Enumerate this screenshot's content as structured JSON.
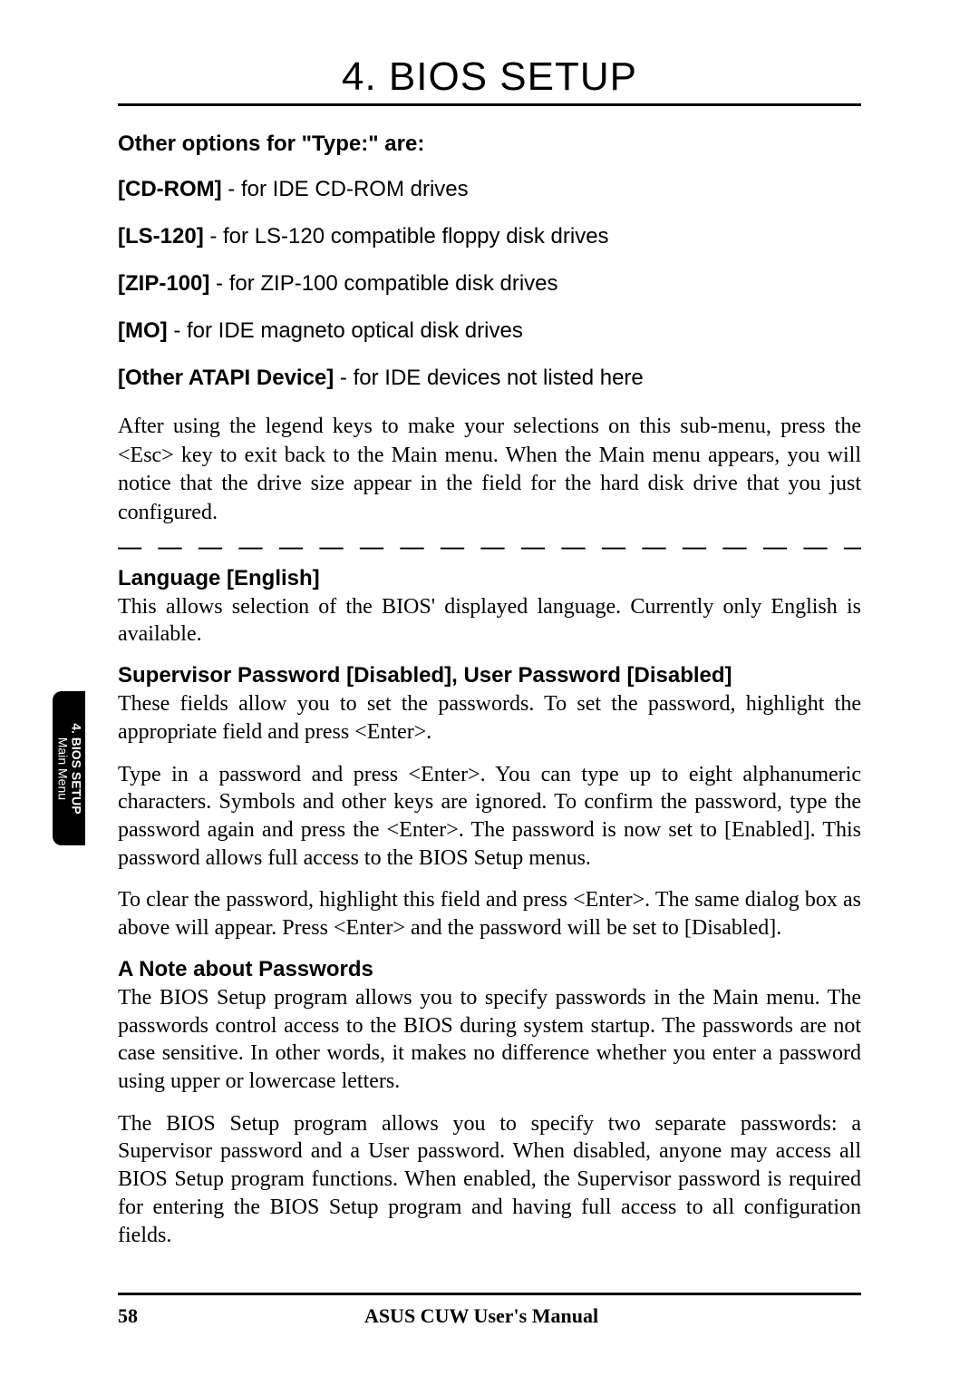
{
  "chapter_title": "4. BIOS SETUP",
  "other_options_heading": "Other options for \"Type:\" are:",
  "options": {
    "cdrom_label": "[CD-ROM]",
    "cdrom_text": " - for IDE CD-ROM drives",
    "ls120_label": "[LS-120]",
    "ls120_text": " - for LS-120 compatible floppy disk drives",
    "zip100_label": "[ZIP-100]",
    "zip100_text": " - for ZIP-100 compatible disk drives",
    "mo_label": "[MO]",
    "mo_text": " - for IDE magneto optical disk drives",
    "atapi_label": "[Other ATAPI Device]",
    "atapi_text": " - for IDE devices not listed here"
  },
  "after_options_para": "After using the legend keys to make your selections on this sub-menu, press the <Esc> key to exit back to the Main menu. When the Main menu appears, you will notice that the drive size appear in the field for the hard disk drive that you just configured.",
  "dashed_divider": "— — — — — — — — — — — — — — — — — — — — — — —",
  "language_heading": "Language [English]",
  "language_para": "This allows selection of the BIOS' displayed language. Currently only English is available.",
  "supervisor_heading": "Supervisor Password [Disabled], User Password [Disabled]",
  "supervisor_para1": "These fields allow you to set the passwords. To set the password, highlight the appropriate field and press <Enter>.",
  "supervisor_para2": "Type in a password and press <Enter>. You can type up to eight alphanumeric characters. Symbols and other keys are ignored. To confirm the password, type the password again and press the <Enter>. The password is now set to [Enabled]. This password allows full access to the BIOS Setup menus.",
  "supervisor_para3": "To clear the password, highlight this field and press <Enter>. The same dialog box as above will appear. Press <Enter> and the password will be set to [Disabled].",
  "note_heading": "A Note about Passwords",
  "note_para1": "The BIOS Setup program allows you to specify passwords in the Main menu. The passwords control access to the BIOS during system startup. The passwords are not case sensitive. In other words, it makes no difference whether you enter a password using upper or lowercase letters.",
  "note_para2": "The BIOS Setup program allows you to specify two separate passwords: a Supervisor password and a User password. When disabled, anyone may access all BIOS Setup program functions. When enabled, the Supervisor password is required for entering the BIOS Setup program and having full access to all configuration fields.",
  "side_tab_bold": "4. BIOS SETUP",
  "side_tab_sub": "Main Menu",
  "footer_page": "58",
  "footer_title": "ASUS CUW User's Manual"
}
